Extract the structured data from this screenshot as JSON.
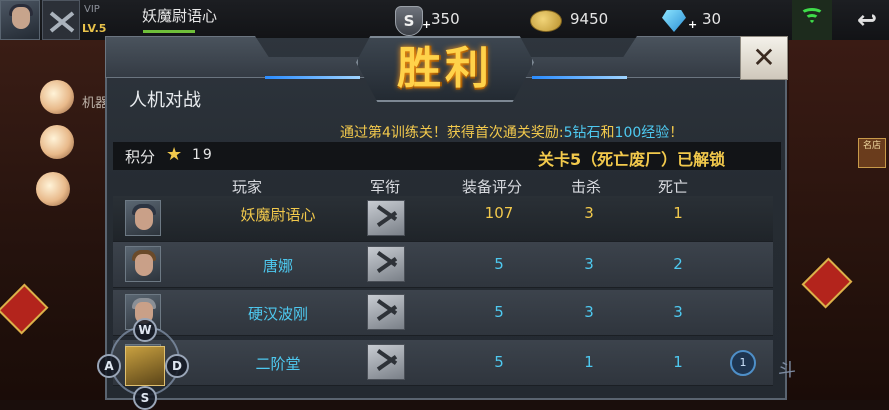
{
  "top_bar": {
    "vip": "VIP",
    "level": "LV.5",
    "player_name": "妖魔尉语心",
    "silver": "350",
    "gold": "9450",
    "diamonds": "30",
    "plus": "+",
    "back_symbol": "↩"
  },
  "result": {
    "title": "胜利",
    "close_symbol": "✕",
    "mode": "人机对战",
    "reward_prefix": "通过第4训练关！获得首次通关奖励:",
    "reward_diamond": "5钻石",
    "reward_and": "和",
    "reward_exp": "100经验",
    "reward_suffix": "！",
    "score_label": "积分",
    "score": "19",
    "unlock": "关卡5（死亡废厂）已解锁"
  },
  "columns": [
    "玩家",
    "军衔",
    "装备评分",
    "击杀",
    "死亡"
  ],
  "players": [
    {
      "name": "妖魔尉语心",
      "gear": "107",
      "kills": "3",
      "deaths": "1"
    },
    {
      "name": "唐娜",
      "gear": "5",
      "kills": "3",
      "deaths": "2"
    },
    {
      "name": "硬汉波刚",
      "gear": "5",
      "kills": "3",
      "deaths": "3"
    },
    {
      "name": "二阶堂",
      "gear": "5",
      "kills": "1",
      "deaths": "1",
      "badge": "1"
    }
  ],
  "joystick": {
    "up": "W",
    "left": "A",
    "right": "D",
    "down": "S"
  },
  "side": {
    "left_label": "机器",
    "right_badge": "名店",
    "right_bottom": "斗"
  },
  "colors": {
    "gold": "#f2c94c",
    "cyan": "#4ec9f0",
    "victory": "#ffd24a"
  }
}
